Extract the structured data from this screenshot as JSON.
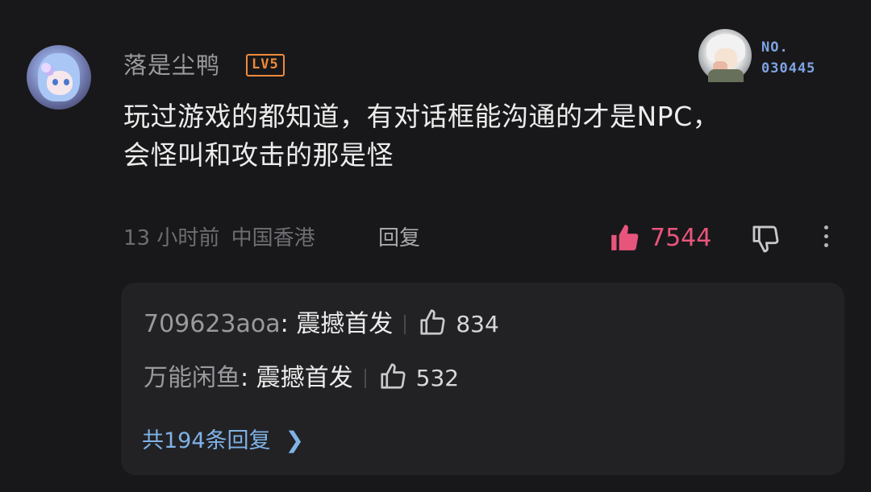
{
  "comment": {
    "username": "落是尘鸭",
    "level": "LV5",
    "fan_badge_number_line1": "NO.",
    "fan_badge_number_line2": "030445",
    "text_line1": "玩过游戏的都知道，有对话框能沟通的才是NPC，",
    "text_line2": "会怪叫和攻击的那是怪",
    "time": "13 小时前",
    "location": "中国香港",
    "reply_label": "回复",
    "like_count": "7544",
    "accent_like_color": "#e8557c"
  },
  "replies": [
    {
      "author": "709623aoa",
      "text": "震撼首发",
      "likes": "834"
    },
    {
      "author": "万能闲鱼",
      "text": "震撼首发",
      "likes": "532"
    }
  ],
  "total_replies_text": "共194条回复",
  "icons": {
    "like": "thumb-up-icon",
    "dislike": "thumb-down-icon",
    "more": "more-vertical-icon",
    "chevron": "chevron-right-icon"
  }
}
